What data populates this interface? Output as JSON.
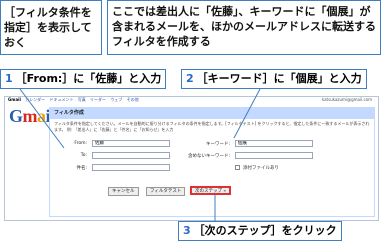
{
  "callouts": {
    "left": "［フィルタ条件を指定］を表示しておく",
    "right": "ここでは差出人に「佐藤」、キーワードに「個展」が含まれるメールを、ほかのメールアドレスに転送するフィルタを作成する"
  },
  "steps": [
    {
      "num": "1",
      "text": "［From:］に「佐藤」と入力"
    },
    {
      "num": "2",
      "text": "［キーワード］に「個展」と入力"
    },
    {
      "num": "3",
      "text": "［次のステップ］をクリック"
    }
  ],
  "gmail": {
    "topbar": [
      "Gmail",
      "カレンダー",
      "ドキュメント",
      "写真",
      "リーダー",
      "ウェブ",
      "その他"
    ],
    "account": "katsukazumi@gmail.com",
    "logo": {
      "g": "G",
      "m": "m",
      "a": "a",
      "i": "i",
      "l": "l"
    },
    "panel_title": "フィルタ作成",
    "description": "フィルタ条件を指定してください。メールを自動的に振り分けるフィルタの条件を指定します。[フィルタテスト] をクリックすると、指定した条件に一致するメールが表示されます。 例: 「差出人」に「佐藤」と「件名」に「お知らせ」を入力",
    "from_label": "From:",
    "from_value": "佐藤",
    "to_label": "To:",
    "to_value": "",
    "subject_label": "件名:",
    "subject_value": "",
    "keyword_label": "キーワード:",
    "keyword_value": "個展",
    "exclude_label": "含めないキーワード:",
    "exclude_value": "",
    "attachment_label": "添付ファイルあり",
    "cancel_button": "キャンセル",
    "test_button": "フィルタテスト",
    "next_button": "次のステップ »"
  }
}
